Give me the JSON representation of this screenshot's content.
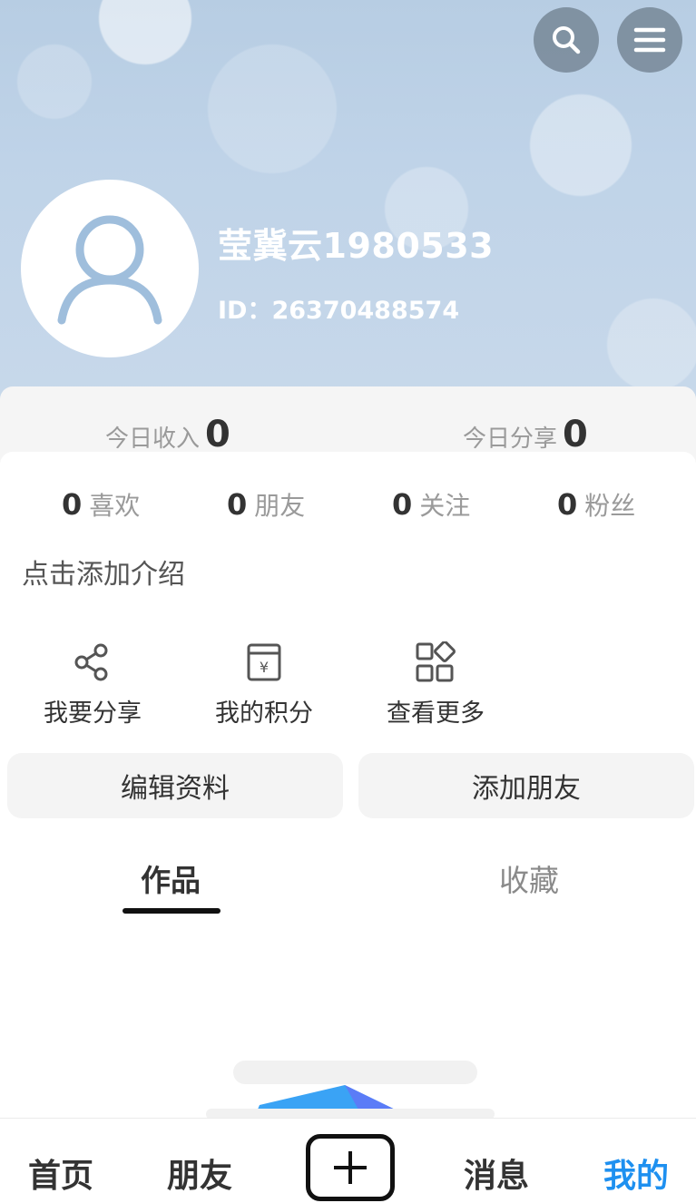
{
  "header": {
    "username": "莹冀云1980533",
    "user_id": "ID：26370488574",
    "search_icon": "search-icon",
    "menu_icon": "menu-icon",
    "avatar_icon": "user-avatar-icon"
  },
  "today": {
    "income_label": "今日收入",
    "income_value": "0",
    "share_label": "今日分享",
    "share_value": "0"
  },
  "counts": [
    {
      "num": "0",
      "label": "喜欢"
    },
    {
      "num": "0",
      "label": "朋友"
    },
    {
      "num": "0",
      "label": "关注"
    },
    {
      "num": "0",
      "label": "粉丝"
    }
  ],
  "intro": "点击添加介绍",
  "actions": [
    {
      "label": "我要分享",
      "icon": "share-icon"
    },
    {
      "label": "我的积分",
      "icon": "points-icon"
    },
    {
      "label": "查看更多",
      "icon": "more-apps-icon"
    }
  ],
  "buttons": {
    "edit_profile": "编辑资料",
    "add_friend": "添加朋友"
  },
  "tabs": [
    {
      "label": "作品",
      "active": true
    },
    {
      "label": "收藏",
      "active": false
    }
  ],
  "bottom_nav": [
    {
      "label": "首页",
      "active": false
    },
    {
      "label": "朋友",
      "active": false
    },
    {
      "label": "消息",
      "active": false
    },
    {
      "label": "我的",
      "active": true
    }
  ],
  "colors": {
    "accent": "#1e90f0",
    "header_bg": "#bfd3e8"
  }
}
